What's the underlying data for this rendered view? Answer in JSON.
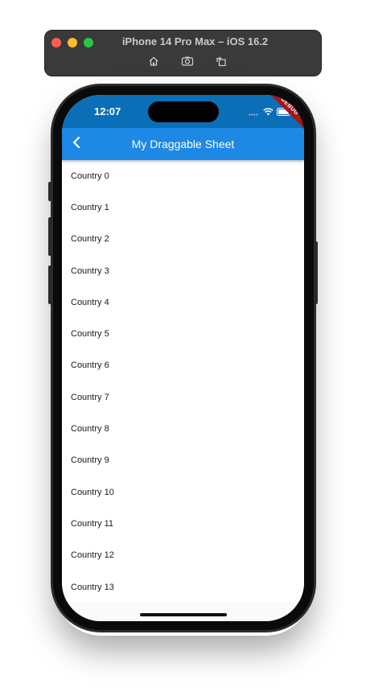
{
  "simulator": {
    "title": "iPhone 14 Pro Max – iOS 16.2",
    "toolbar": [
      {
        "icon": "home-icon"
      },
      {
        "icon": "screenshot-icon"
      },
      {
        "icon": "rotate-icon"
      }
    ]
  },
  "status_bar": {
    "time": "12:07",
    "debug_label": "DEBUG"
  },
  "app_bar": {
    "title": "My Draggable Sheet",
    "back_icon": "chevron-left-icon"
  },
  "list": {
    "items": [
      "Country 0",
      "Country 1",
      "Country 2",
      "Country 3",
      "Country 4",
      "Country 5",
      "Country 6",
      "Country 7",
      "Country 8",
      "Country 9",
      "Country 10",
      "Country 11",
      "Country 12",
      "Country 13"
    ]
  },
  "colors": {
    "app_bar": "#1e88e5",
    "status_bar": "#0b6fb8",
    "debug_banner": "#a4161a"
  }
}
